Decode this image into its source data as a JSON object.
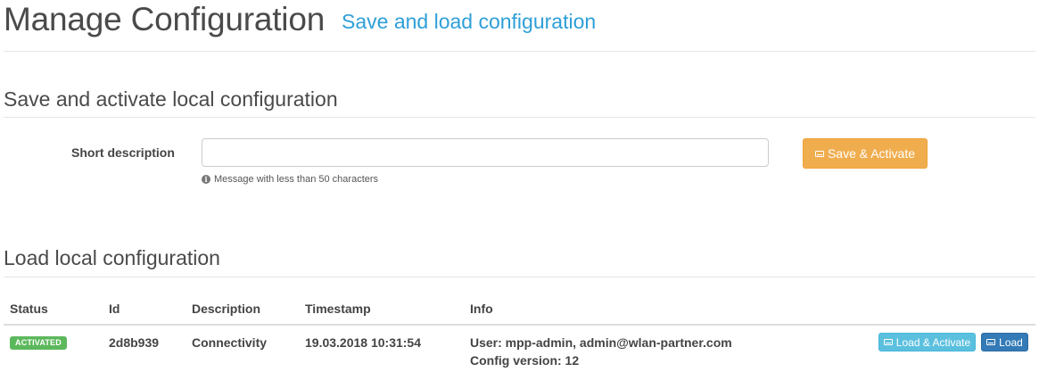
{
  "header": {
    "title": "Manage Configuration",
    "subtitle": "Save and load configuration"
  },
  "save_section": {
    "title": "Save and activate local configuration",
    "short_description_label": "Short description",
    "short_description_value": "",
    "short_description_placeholder": "",
    "help_text": "Message with less than 50 characters",
    "save_activate_label": "Save & Activate",
    "icons": {
      "help": "info-circle-icon",
      "button": "hdd-icon"
    },
    "colors": {
      "button": "#f0ad4e"
    }
  },
  "load_section": {
    "title": "Load local configuration",
    "columns": [
      "Status",
      "Id",
      "Description",
      "Timestamp",
      "Info"
    ],
    "rows": [
      {
        "status": "ACTIVATED",
        "id": "2d8b939",
        "description": "Connectivity",
        "timestamp": "19.03.2018 10:31:54",
        "info_user": "User: mpp-admin, admin@wlan-partner.com",
        "info_version": "Config version: 12",
        "load_activate_label": "Load & Activate",
        "load_label": "Load"
      }
    ],
    "colors": {
      "status_badge": "#5cb85c",
      "load_activate_button": "#5bc0de",
      "load_button": "#337ab7"
    }
  }
}
